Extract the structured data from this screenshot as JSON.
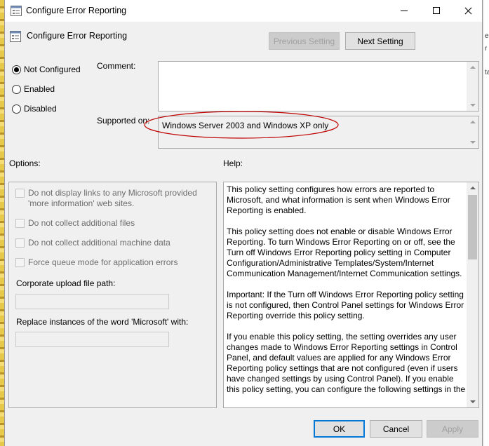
{
  "window": {
    "title": "Configure Error Reporting"
  },
  "header": {
    "policy_name": "Configure Error Reporting",
    "previous_label": "Previous Setting",
    "next_label": "Next Setting"
  },
  "state": {
    "options": [
      {
        "label": "Not Configured",
        "selected": true
      },
      {
        "label": "Enabled",
        "selected": false
      },
      {
        "label": "Disabled",
        "selected": false
      }
    ]
  },
  "comment": {
    "label": "Comment:",
    "value": ""
  },
  "supported": {
    "label": "Supported on:",
    "value": "Windows Server 2003 and Windows XP only"
  },
  "options_panel": {
    "label": "Options:",
    "checkboxes": [
      {
        "label": "Do not display links to any Microsoft provided 'more information' web sites.",
        "checked": false
      },
      {
        "label": "Do not collect additional files",
        "checked": false
      },
      {
        "label": "Do not collect additional machine data",
        "checked": false
      },
      {
        "label": "Force queue mode for application errors",
        "checked": false
      }
    ],
    "upload_path_label": "Corporate upload file path:",
    "upload_path_value": "",
    "replace_label": "Replace instances of the word 'Microsoft' with:",
    "replace_value": ""
  },
  "help": {
    "label": "Help:",
    "paragraphs": [
      "This policy setting configures how errors are reported to Microsoft, and what information is sent when Windows Error Reporting is enabled.",
      "This policy setting does not enable or disable Windows Error Reporting. To turn Windows Error Reporting on or off, see the Turn off Windows Error Reporting policy setting in Computer Configuration/Administrative Templates/System/Internet Communication Management/Internet Communication settings.",
      "Important: If the Turn off Windows Error Reporting policy setting is not configured, then Control Panel settings for Windows Error Reporting override this policy setting.",
      "If you enable this policy setting, the setting overrides any user changes made to Windows Error Reporting settings in Control Panel, and default values are applied for any Windows Error Reporting policy settings that are not configured (even if users have changed settings by using Control Panel). If you enable this policy setting, you can configure the following settings in the"
    ]
  },
  "footer": {
    "ok_label": "OK",
    "cancel_label": "Cancel",
    "apply_label": "Apply"
  },
  "background": {
    "right_glyphs": [
      "e",
      "r",
      "ta"
    ]
  },
  "colors": {
    "accent": "#0078d7",
    "ellipse": "#c00000"
  }
}
